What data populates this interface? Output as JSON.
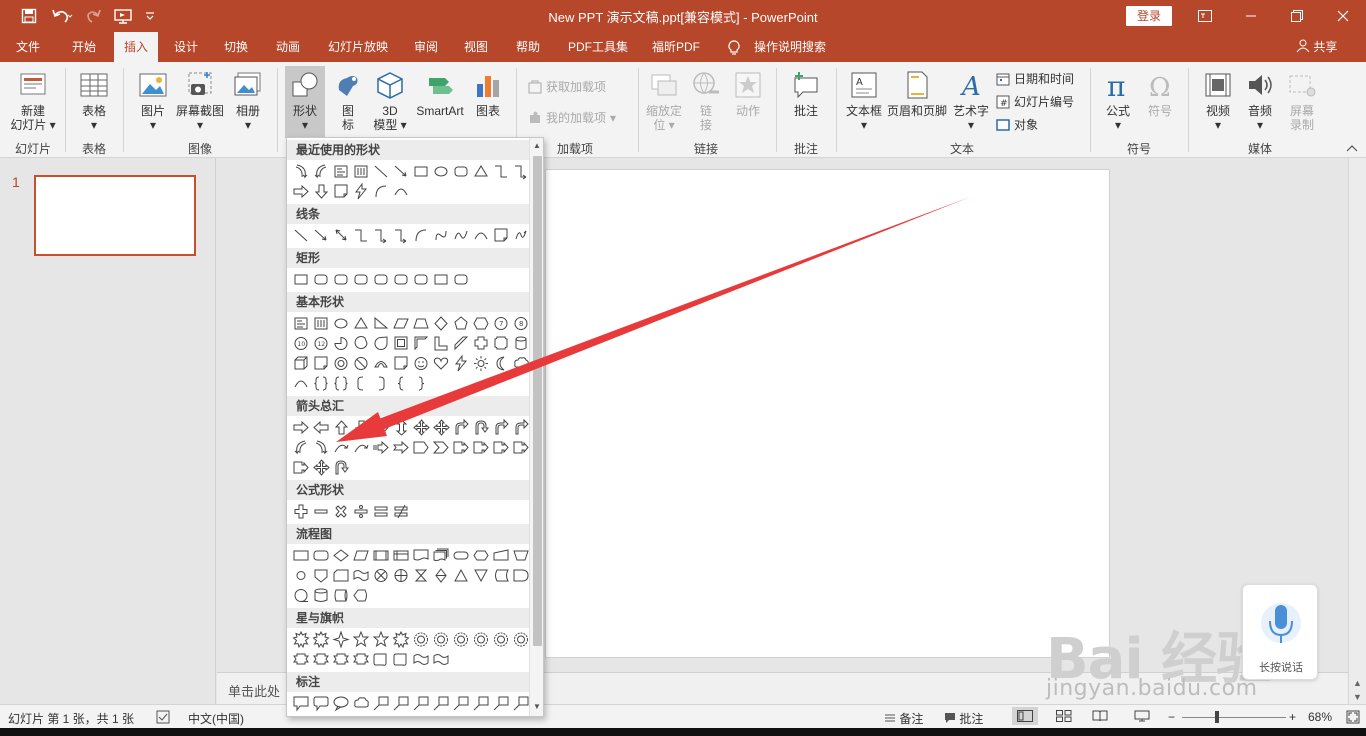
{
  "titlebar": {
    "title": "New PPT 演示文稿.ppt[兼容模式]  -  PowerPoint",
    "login": "登录",
    "icons": [
      "save-icon",
      "undo-icon",
      "redo-icon",
      "start-from-beginning-icon",
      "customize-qat-icon"
    ],
    "window_icons": [
      "ribbon-display-icon",
      "minimize-icon",
      "restore-icon",
      "close-icon"
    ]
  },
  "tabs": [
    {
      "label": "文件"
    },
    {
      "label": "开始"
    },
    {
      "label": "插入",
      "active": true
    },
    {
      "label": "设计"
    },
    {
      "label": "切换"
    },
    {
      "label": "动画"
    },
    {
      "label": "幻灯片放映"
    },
    {
      "label": "审阅"
    },
    {
      "label": "视图"
    },
    {
      "label": "帮助"
    },
    {
      "label": "PDF工具集"
    },
    {
      "label": "福昕PDF"
    },
    {
      "label": "操作说明搜索"
    }
  ],
  "share": "共享",
  "ribbon": {
    "new_slide_line1": "新建",
    "new_slide_line2": "幻灯片",
    "table": "表格",
    "picture": "图片",
    "screenshot": "屏幕截图",
    "album": "相册",
    "shapes": "形状",
    "icons_line1": "图",
    "icons_line2": "标",
    "model3d_line1": "3D",
    "model3d_line2": "模型",
    "smartart": "SmartArt",
    "chart": "图表",
    "get_addins": "获取加载项",
    "my_addins": "我的加载项",
    "zoom_line1": "缩放定",
    "zoom_line2": "位",
    "link_line1": "链",
    "link_line2": "接",
    "action": "动作",
    "comment": "批注",
    "textbox": "文本框",
    "header_footer": "页眉和页脚",
    "wordart": "艺术字",
    "date_time": "日期和时间",
    "slide_number": "幻灯片编号",
    "object": "对象",
    "equation": "公式",
    "symbol": "符号",
    "video": "视频",
    "audio": "音频",
    "screen_record_line1": "屏幕",
    "screen_record_line2": "录制",
    "groups": {
      "slides": "幻灯片",
      "tables": "表格",
      "images": "图像",
      "addins": "加载项",
      "links": "链接",
      "comments": "批注",
      "text": "文本",
      "symbols": "符号",
      "media": "媒体"
    }
  },
  "shapes_menu": {
    "sections": [
      {
        "title": "最近使用的形状"
      },
      {
        "title": "线条"
      },
      {
        "title": "矩形"
      },
      {
        "title": "基本形状"
      },
      {
        "title": "箭头总汇"
      },
      {
        "title": "公式形状"
      },
      {
        "title": "流程图"
      },
      {
        "title": "星与旗帜"
      },
      {
        "title": "标注"
      }
    ]
  },
  "thumbnails": {
    "slide_number": "1"
  },
  "notes_placeholder": "单击此处",
  "voice_widget": {
    "label": "长按说话"
  },
  "watermark": {
    "text": "Bai 经验",
    "url": "jingyan.baidu.com"
  },
  "statusbar": {
    "slide_info": "幻灯片 第 1 张，共 1 张",
    "language": "中文(中国)",
    "notes": "备注",
    "comments": "批注",
    "zoom": "68%",
    "zoom_level": 0.68
  },
  "colors": {
    "accent": "#b7472a",
    "arrow": "#e83a3a"
  }
}
